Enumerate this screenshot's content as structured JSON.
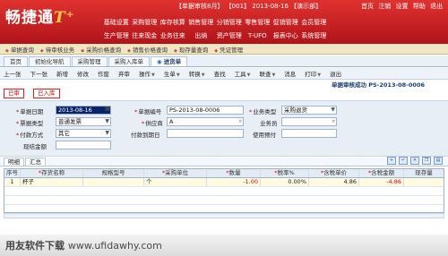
{
  "header": {
    "logo": "畅捷通",
    "logo_suffix": "T⁺",
    "info": "【单据审核8月】  【001】 2013-08-16  【演示部】",
    "links": [
      "首页",
      "注销",
      "设置",
      "帮助",
      "退出"
    ]
  },
  "main_nav": [
    [
      "基础设置",
      "采购管理",
      "库存核算",
      "销售管理",
      "分销管理",
      "零售管理",
      "促销管理",
      "会员管理"
    ],
    [
      "生产管理",
      "往来现金",
      "业务往来",
      "出纳",
      "资产管理",
      "T-UFO",
      "报表中心",
      "系统管理"
    ]
  ],
  "quickbar": [
    "单据查询",
    "待审核业务",
    "采购价格查询",
    "销售价格查询",
    "现存量查询",
    "凭证管理"
  ],
  "tabs": [
    "首页",
    "初始化导航",
    "采购管理",
    "采购入库单",
    "进货单"
  ],
  "toolbar": [
    "上一张",
    "下一张",
    "新增",
    "修改",
    "作废",
    "弃审",
    "操作",
    "生单",
    "转换",
    "查找",
    "工具",
    "联查",
    "消息",
    "打印",
    "退出"
  ],
  "status_message": "单据审核成功  PS-2013-08-0006",
  "actions": {
    "reviewed": "已审",
    "stocked_in": "已入库"
  },
  "form": {
    "doc_date": {
      "label": "单据日期",
      "value": "2013-08-16"
    },
    "doc_no": {
      "label": "单据编号",
      "value": "PS-2013-08-0006"
    },
    "biz_type": {
      "label": "业务类型",
      "value": "采购退货"
    },
    "invoice_type": {
      "label": "票据类型",
      "value": "普通发票"
    },
    "supplier": {
      "label": "供应商",
      "value": "A"
    },
    "salesperson": {
      "label": "业务员",
      "value": ""
    },
    "payment": {
      "label": "付款方式",
      "value": "其它"
    },
    "due_date": {
      "label": "付款到期日",
      "value": ""
    },
    "prepay": {
      "label": "使用预付",
      "value": ""
    },
    "tax_amount": {
      "label": "现结金额",
      "value": ""
    }
  },
  "detail_tabs": [
    "明细",
    "汇总"
  ],
  "grid": {
    "columns": [
      "序号",
      "存货名称",
      "规格型号",
      "采购单位",
      "数量",
      "税率%",
      "含税单价",
      "含税金额",
      "现存量"
    ],
    "rows": [
      [
        "1",
        "杯子",
        "",
        "个",
        "-1.00",
        "0.00%",
        "4.86",
        "-4.86",
        ""
      ]
    ]
  },
  "watermark": {
    "text": "用友软件下载",
    "url": "www.ufidawhy.com"
  },
  "colors": {
    "brand_red": "#c41e24",
    "required": "#d00000",
    "selection": "#0a246a"
  }
}
